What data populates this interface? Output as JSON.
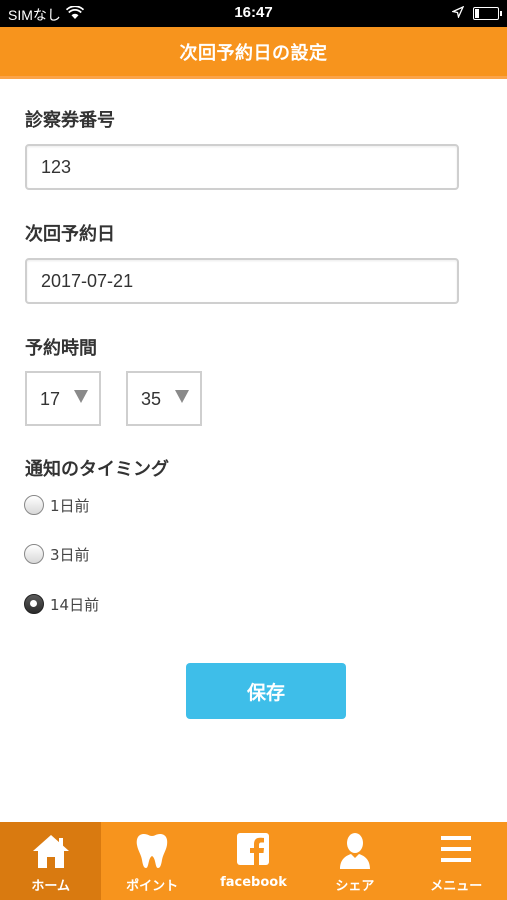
{
  "status_bar": {
    "carrier": "SIMなし",
    "time": "16:47"
  },
  "header": {
    "title": "次回予約日の設定"
  },
  "form": {
    "patient_card_label": "診察券番号",
    "patient_card_value": "123",
    "next_date_label": "次回予約日",
    "next_date_value": "2017-07-21",
    "time_label": "予約時間",
    "hour_value": "17",
    "minute_value": "35",
    "timing_label": "通知のタイミング",
    "timing_options": [
      {
        "label": "1日前",
        "checked": false
      },
      {
        "label": "3日前",
        "checked": false
      },
      {
        "label": "14日前",
        "checked": true
      }
    ],
    "save_label": "保存"
  },
  "tabbar": {
    "items": [
      {
        "label": "ホーム",
        "icon": "home-icon",
        "active": true
      },
      {
        "label": "ポイント",
        "icon": "tooth-icon",
        "active": false
      },
      {
        "label": "facebook",
        "icon": "facebook-icon",
        "active": false
      },
      {
        "label": "シェア",
        "icon": "person-icon",
        "active": false
      },
      {
        "label": "メニュー",
        "icon": "menu-icon",
        "active": false
      }
    ]
  },
  "colors": {
    "accent": "#f7941d",
    "accent_dark": "#d97a10",
    "button": "#3ebee9"
  }
}
